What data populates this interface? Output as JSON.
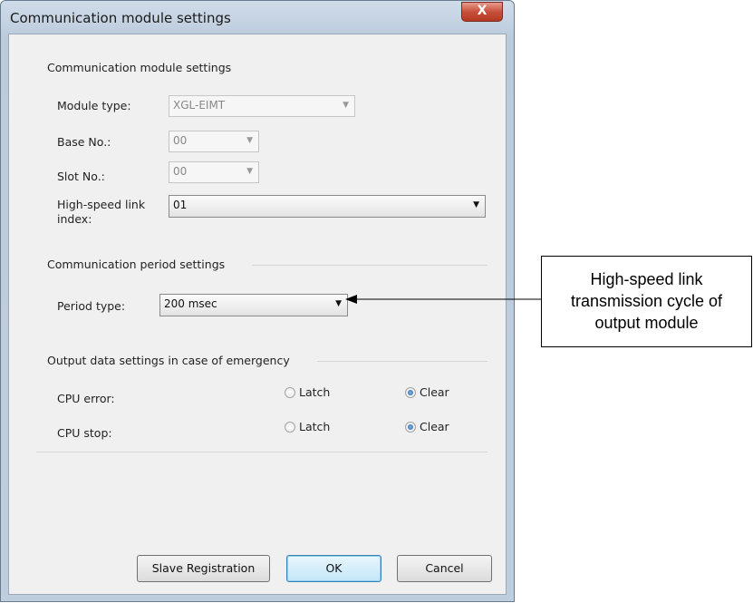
{
  "window": {
    "title": "Communication module settings",
    "close_glyph": "X"
  },
  "module_group": {
    "label": "Communication module settings",
    "module_type": {
      "label": "Module type:",
      "value": "XGL-EIMT"
    },
    "base_no": {
      "label": "Base No.:",
      "value": "00"
    },
    "slot_no": {
      "label": "Slot No.:",
      "value": "00"
    },
    "link_index": {
      "label_line1": "High-speed link",
      "label_line2": "index:",
      "value": "01"
    }
  },
  "period_group": {
    "label": "Communication period settings",
    "period_type": {
      "label": "Period type:",
      "value": "200 msec"
    }
  },
  "emergency_group": {
    "label": "Output data settings in case of emergency",
    "cpu_error": {
      "label": "CPU error:",
      "latch": "Latch",
      "clear": "Clear",
      "selected": "Clear"
    },
    "cpu_stop": {
      "label": "CPU stop:",
      "latch": "Latch",
      "clear": "Clear",
      "selected": "Clear"
    }
  },
  "buttons": {
    "slave_registration": "Slave Registration",
    "ok": "OK",
    "cancel": "Cancel"
  },
  "callout": {
    "line1": "High-speed link",
    "line2": "transmission cycle of",
    "line3": "output module"
  },
  "icons": {
    "dropdown": "dropdown-arrow-icon",
    "close": "close-icon"
  }
}
